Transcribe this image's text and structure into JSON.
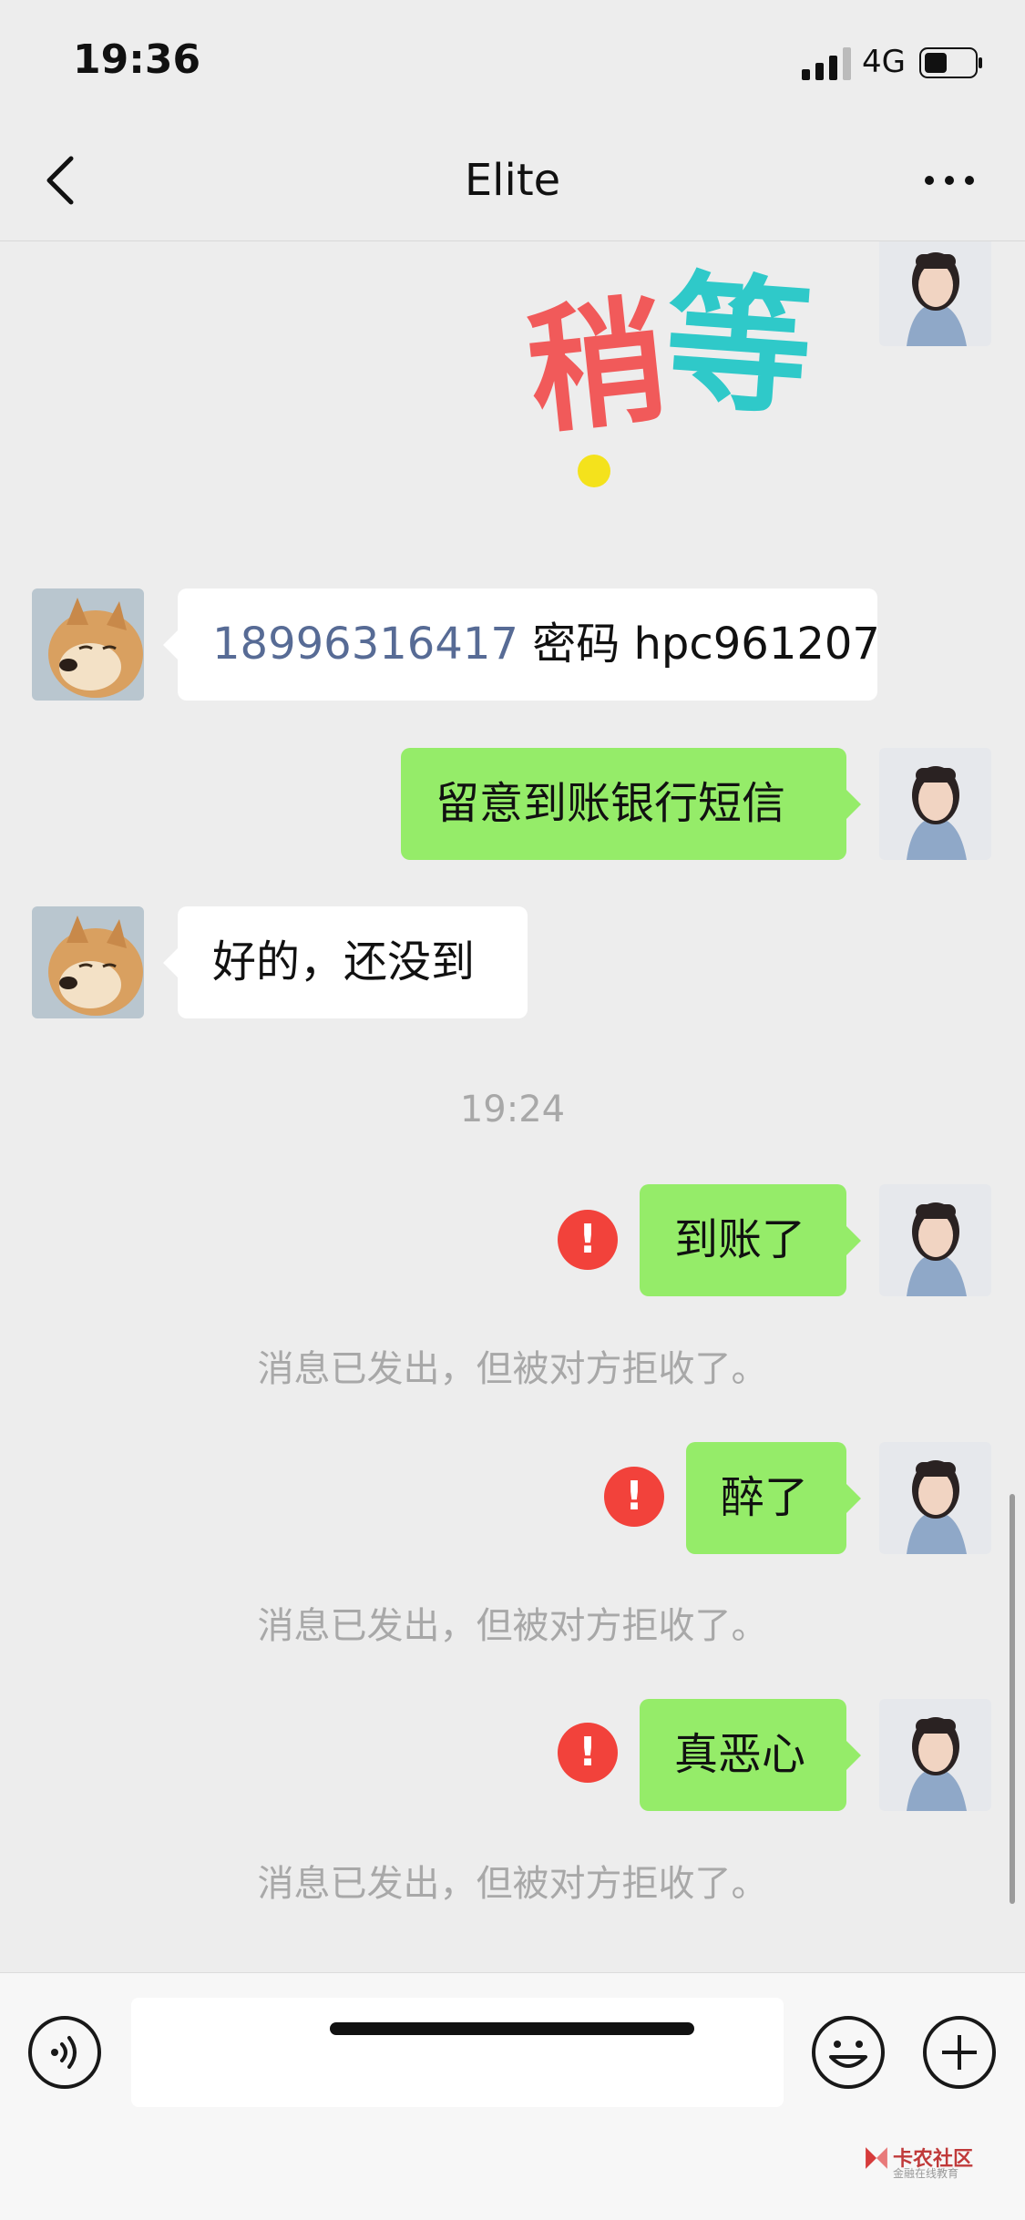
{
  "status_bar": {
    "time": "19:36",
    "network": "4G"
  },
  "nav": {
    "title": "Elite"
  },
  "sticker": {
    "text_left": "稍",
    "text_right": "等"
  },
  "messages": [
    {
      "side": "received",
      "phone": "18996316417",
      "text": " 密码 hpc961207"
    },
    {
      "side": "sent",
      "text": "留意到账银行短信"
    },
    {
      "side": "received",
      "text": "好的，还没到"
    }
  ],
  "time_separator": "19:24",
  "rejected_messages": [
    {
      "text": "到账了",
      "notice": "消息已发出，但被对方拒收了。"
    },
    {
      "text": "醉了",
      "notice": "消息已发出，但被对方拒收了。"
    },
    {
      "text": "真恶心",
      "notice": "消息已发出，但被对方拒收了。"
    }
  ],
  "error_mark": "!",
  "watermark": {
    "title": "卡农社区",
    "subtitle": "金融在线教育"
  },
  "colors": {
    "background": "#ededed",
    "sent_bubble": "#95ec69",
    "received_bubble": "#ffffff",
    "error": "#f2423b",
    "link": "#576b95"
  }
}
